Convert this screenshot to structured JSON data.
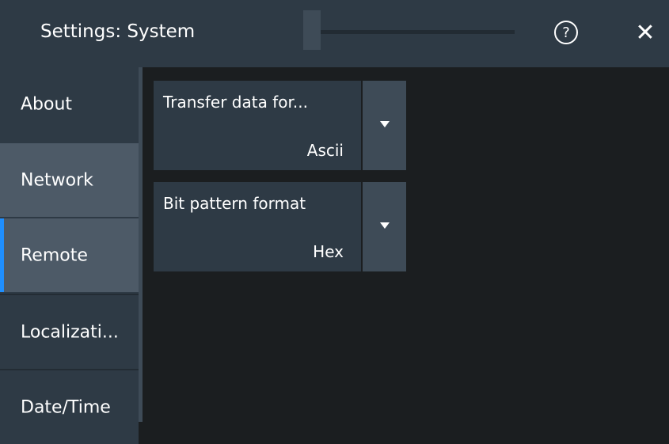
{
  "header": {
    "title": "Settings: System",
    "help_glyph": "?",
    "close_glyph": "✕",
    "help_icon": "help-circle-icon",
    "close_icon": "close-icon"
  },
  "sidebar": {
    "items": [
      {
        "label": "About"
      },
      {
        "label": "Network"
      },
      {
        "label": "Remote"
      },
      {
        "label": "Localizati..."
      },
      {
        "label": "Date/Time"
      }
    ],
    "selected": "Remote",
    "accent_color": "#1f8fff"
  },
  "main": {
    "fields": [
      {
        "label": "Transfer data for...",
        "value": "Ascii",
        "dropdown_icon": "dropdown-arrow-icon"
      },
      {
        "label": "Bit pattern format",
        "value": "Hex",
        "dropdown_icon": "dropdown-arrow-icon"
      }
    ]
  },
  "colors": {
    "background": "#1b1e20",
    "panel": "#2e3a45",
    "panel_light": "#4d5a67",
    "button": "#3e4b57"
  }
}
